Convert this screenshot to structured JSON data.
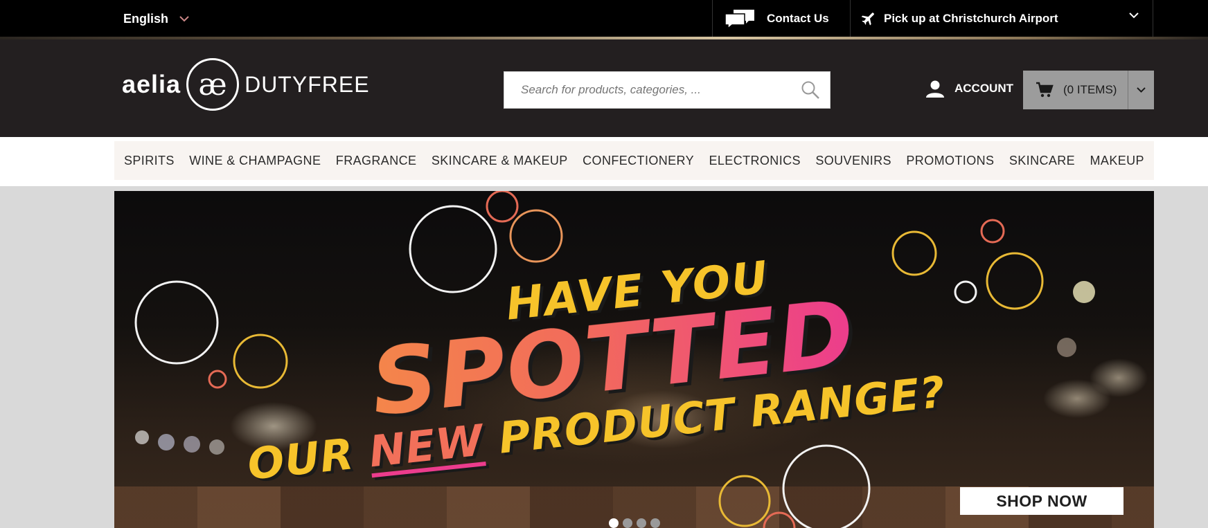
{
  "topbar": {
    "language": "English",
    "contact_label": "Contact Us",
    "pickup_label": "Pick up at Christchurch Airport"
  },
  "header": {
    "logo_word": "aelia",
    "logo_mark": "æ",
    "logo_suffix": "DUTYFREE",
    "search_placeholder": "Search for products, categories, ...",
    "account_label": "ACCOUNT",
    "cart_label": "(0 ITEMS)"
  },
  "nav": {
    "items": [
      "SPIRITS",
      "WINE & CHAMPAGNE",
      "FRAGRANCE",
      "SKINCARE & MAKEUP",
      "CONFECTIONERY",
      "ELECTRONICS",
      "SOUVENIRS",
      "PROMOTIONS",
      "SKINCARE",
      "MAKEUP"
    ]
  },
  "banner": {
    "line1": "HAVE YOU",
    "line2": "SPOTTED",
    "line3_a": "OUR",
    "line3_b": "NEW",
    "line3_c": "PRODUCT RANGE?",
    "cta": "SHOP NOW",
    "slide_count": 4,
    "active_slide": 1
  },
  "colors": {
    "topbar_bg": "#000000",
    "header_bg": "#231f20",
    "nav_bg": "#f8f4f1",
    "headline_yellow": "#f6c32a",
    "headline_pink": "#ec3c8d",
    "headline_orange": "#f4864a"
  },
  "icons": {
    "language_chevron": "chevron-down-icon",
    "contact": "chat-bubbles-icon",
    "pickup": "airplane-icon",
    "search": "search-icon",
    "account": "user-icon",
    "cart": "cart-icon"
  }
}
